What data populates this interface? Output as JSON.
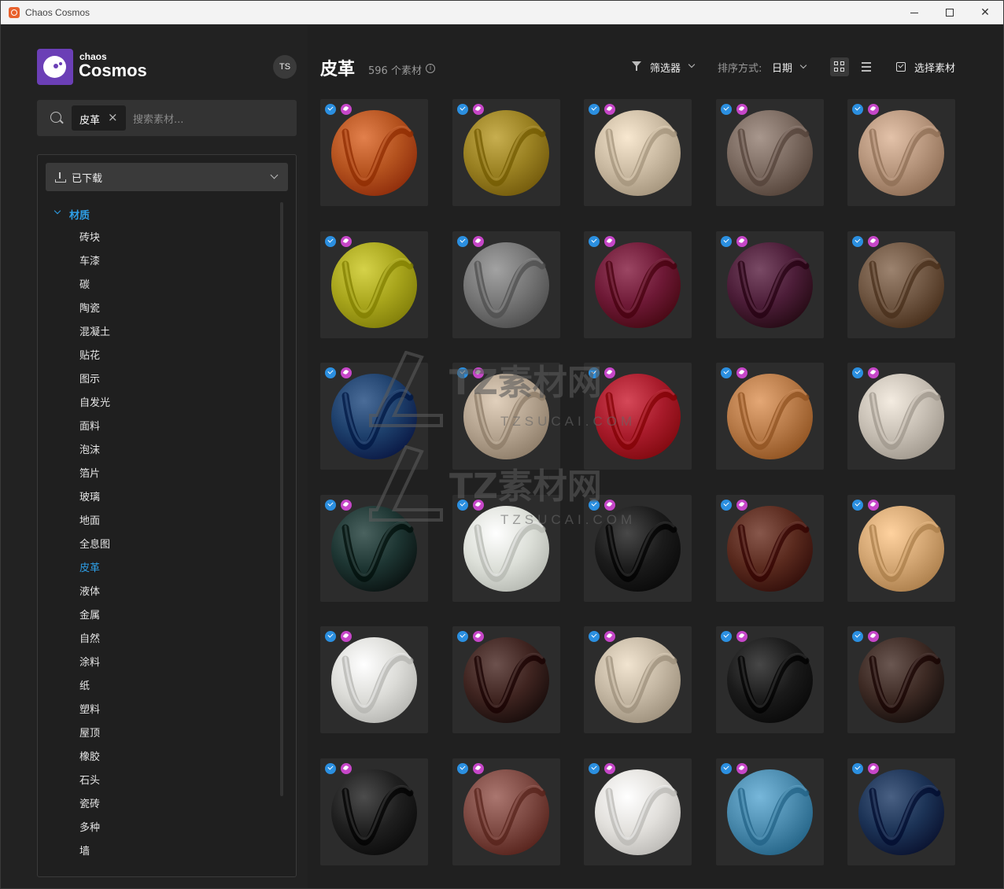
{
  "window": {
    "title": "Chaos Cosmos"
  },
  "brand": {
    "small": "chaos",
    "big": "Cosmos"
  },
  "user": {
    "initials": "TS"
  },
  "search": {
    "chip_label": "皮革",
    "chip_close": "×",
    "placeholder": "搜索素材..."
  },
  "sidebar": {
    "download_filter": "已下载",
    "category_header": "材质",
    "active_item": "皮革",
    "items": [
      "砖块",
      "车漆",
      "碳",
      "陶瓷",
      "混凝土",
      "贴花",
      "图示",
      "自发光",
      "面料",
      "泡沫",
      "箔片",
      "玻璃",
      "地面",
      "全息图",
      "皮革",
      "液体",
      "金属",
      "自然",
      "涂料",
      "纸",
      "塑料",
      "屋顶",
      "橡胶",
      "石头",
      "瓷砖",
      "多种",
      "墙"
    ]
  },
  "header": {
    "title": "皮革",
    "count": "596 个素材",
    "info_glyph": "i",
    "filter_label": "筛选器",
    "sort_label": "排序方式:",
    "sort_value": "日期",
    "select_label": "选择素材"
  },
  "materials": [
    {
      "color": "#b5531f"
    },
    {
      "color": "#9a8122"
    },
    {
      "color": "#cbbba3"
    },
    {
      "color": "#7b6a60"
    },
    {
      "color": "#b6957c"
    },
    {
      "color": "#a8a51c"
    },
    {
      "color": "#757575"
    },
    {
      "color": "#6e1936"
    },
    {
      "color": "#4c1d38"
    },
    {
      "color": "#6f5642"
    },
    {
      "color": "#1d3f6b"
    },
    {
      "color": "#b4a38f"
    },
    {
      "color": "#a81b2b"
    },
    {
      "color": "#b77a48"
    },
    {
      "color": "#c7bfb4"
    },
    {
      "color": "#1d3532"
    },
    {
      "color": "#dcdfd8"
    },
    {
      "color": "#1b1b1b"
    },
    {
      "color": "#5a2a1e"
    },
    {
      "color": "#d2a572"
    },
    {
      "color": "#dcdcd8"
    },
    {
      "color": "#3f2420"
    },
    {
      "color": "#c4b7a3"
    },
    {
      "color": "#1a1a1a"
    },
    {
      "color": "#3d2a24"
    },
    {
      "color": "#1f1f1f"
    },
    {
      "color": "#7d4942"
    },
    {
      "color": "#e2e0dc"
    },
    {
      "color": "#4a8aad"
    },
    {
      "color": "#1c3356"
    }
  ],
  "watermark": {
    "line1": "TZ素材网",
    "line2": "TZSUCAI.COM"
  },
  "accent": "#2e9ee6"
}
